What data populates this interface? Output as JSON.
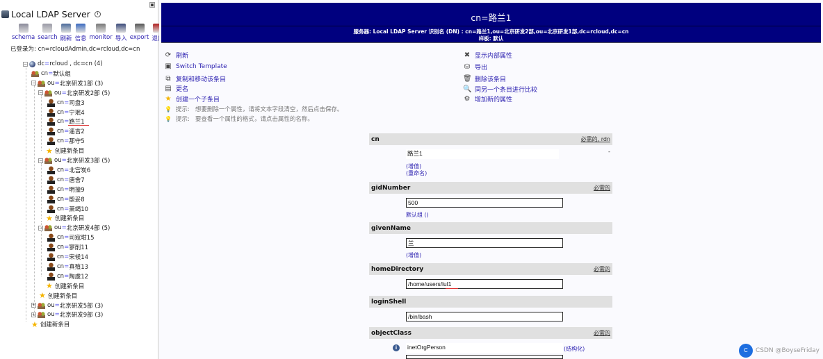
{
  "left": {
    "server_name": "Local LDAP Server",
    "toolbar": [
      {
        "label": "schema",
        "icon": "schema-icon",
        "color": "#8a8a9a"
      },
      {
        "label": "search",
        "icon": "search-icon",
        "color": "#9a9aa6"
      },
      {
        "label": "刷新",
        "icon": "refresh-icon",
        "color": "#4a6a9a"
      },
      {
        "label": "信息",
        "icon": "info-icon",
        "color": "#3a6ac0"
      },
      {
        "label": "monitor",
        "icon": "monitor-icon",
        "color": "#777777"
      },
      {
        "label": "导入",
        "icon": "import-icon",
        "color": "#3a4a7a"
      },
      {
        "label": "export",
        "icon": "export-icon",
        "color": "#555555"
      },
      {
        "label": "退出",
        "icon": "logout-icon",
        "color": "#b02020"
      }
    ],
    "login_label": "已登录为: cn=rcloudAdmin,dc=rcloud,dc=cn",
    "tree": [
      {
        "type": "root",
        "attr": "dc",
        "val": "rcloud , dc=cn (4)",
        "expander": "−"
      },
      {
        "type": "group",
        "attr": "cn",
        "val": "默认组"
      },
      {
        "type": "ou",
        "attr": "ou",
        "val": "北京研发1部 (3)",
        "expander": "−"
      },
      {
        "type": "ou",
        "attr": "ou",
        "val": "北京研发2部 (5)",
        "expander": "−"
      },
      {
        "type": "user",
        "attr": "cn",
        "val": "司盘3"
      },
      {
        "type": "user",
        "attr": "cn",
        "val": "宁珉4"
      },
      {
        "type": "user",
        "attr": "cn",
        "val": "路兰1"
      },
      {
        "type": "user",
        "attr": "cn",
        "val": "遥吉2"
      },
      {
        "type": "user",
        "attr": "cn",
        "val": "那守5"
      },
      {
        "type": "new",
        "label": "创建新条目"
      },
      {
        "type": "ou",
        "attr": "ou",
        "val": "北京研发3部 (5)",
        "expander": "−"
      },
      {
        "type": "user",
        "attr": "cn",
        "val": "北宫炭6"
      },
      {
        "type": "user",
        "attr": "cn",
        "val": "唐舍7"
      },
      {
        "type": "user",
        "attr": "cn",
        "val": "明撞9"
      },
      {
        "type": "user",
        "attr": "cn",
        "val": "殷妥8"
      },
      {
        "type": "user",
        "attr": "cn",
        "val": "萧竭10"
      },
      {
        "type": "new",
        "label": "创建新条目"
      },
      {
        "type": "ou",
        "attr": "ou",
        "val": "北京研发4部 (5)",
        "expander": "−"
      },
      {
        "type": "user",
        "attr": "cn",
        "val": "司寇坩15"
      },
      {
        "type": "user",
        "attr": "cn",
        "val": "寥削11"
      },
      {
        "type": "user",
        "attr": "cn",
        "val": "宋候14"
      },
      {
        "type": "user",
        "attr": "cn",
        "val": "真殖13"
      },
      {
        "type": "user",
        "attr": "cn",
        "val": "陶虞12"
      },
      {
        "type": "new",
        "label": "创建新条目"
      },
      {
        "type": "new",
        "label": "创建新条目"
      },
      {
        "type": "ou",
        "attr": "ou",
        "val": "北京研发5部 (3)",
        "expander": "+"
      },
      {
        "type": "ou",
        "attr": "ou",
        "val": "北京研发9部 (3)",
        "expander": "+"
      },
      {
        "type": "new",
        "label": "创建新条目"
      }
    ]
  },
  "banner": {
    "title": "cn=路兰1",
    "server_line": "服务器: Local LDAP Server   识别名 (DN) : cn=路兰1,ou=北京研发2部,ou=北京研发1部,dc=rcloud,dc=cn",
    "template_line": "样板: 默认"
  },
  "actions_left": [
    {
      "label": "刷新",
      "icon": "refresh-icon",
      "glyph": "⟳"
    },
    {
      "label": "Switch Template",
      "icon": "template-icon",
      "glyph": "▣"
    },
    {
      "label": "复制和移动该条目",
      "icon": "copy-icon",
      "glyph": "⧉"
    },
    {
      "label": "更名",
      "icon": "rename-icon",
      "glyph": "▤"
    },
    {
      "label": "创建一个子条目",
      "icon": "star-icon",
      "glyph": "★"
    }
  ],
  "hints": [
    {
      "prefix": "提示:",
      "text": "想要删除一个属性，请将文本字段清空，然后点击保存。"
    },
    {
      "prefix": "提示:",
      "text": "要查看一个属性的格式，请点击属性的名称。"
    }
  ],
  "actions_right": [
    {
      "label": "显示内部属性",
      "icon": "tools-icon",
      "glyph": "✖"
    },
    {
      "label": "导出",
      "icon": "export-icon",
      "glyph": "⛁"
    },
    {
      "label": "删除该条目",
      "icon": "trash-icon",
      "glyph": "🗑"
    },
    {
      "label": "同另一个条目进行比较",
      "icon": "compare-icon",
      "glyph": "🔍"
    },
    {
      "label": "增加新的属性",
      "icon": "add-attr-icon",
      "glyph": "⚙"
    }
  ],
  "attributes": [
    {
      "name": "cn",
      "flag": "必需的, rdn",
      "value": "路兰1",
      "links": [
        "(增值)",
        "(重命名)"
      ],
      "plain": true
    },
    {
      "name": "gidNumber",
      "flag": "必需的",
      "value": "500",
      "links": [
        "默认组 ()"
      ]
    },
    {
      "name": "givenName",
      "flag": "",
      "value": "兰",
      "links": [
        "(增值)"
      ]
    },
    {
      "name": "homeDirectory",
      "flag": "必需的",
      "value": "/home/users/lul1",
      "links": []
    },
    {
      "name": "loginShell",
      "flag": "",
      "value": "/bin/bash",
      "links": []
    },
    {
      "name": "objectClass",
      "flag": "必需的",
      "value": "inetOrgPerson",
      "links": [
        "(结构化)"
      ],
      "plain": true
    }
  ],
  "watermark": "CSDN @BoyseFriday",
  "colors": {
    "banner": "#00007f",
    "link": "#2a1fb0",
    "attr_header": "#e0e0e0"
  }
}
